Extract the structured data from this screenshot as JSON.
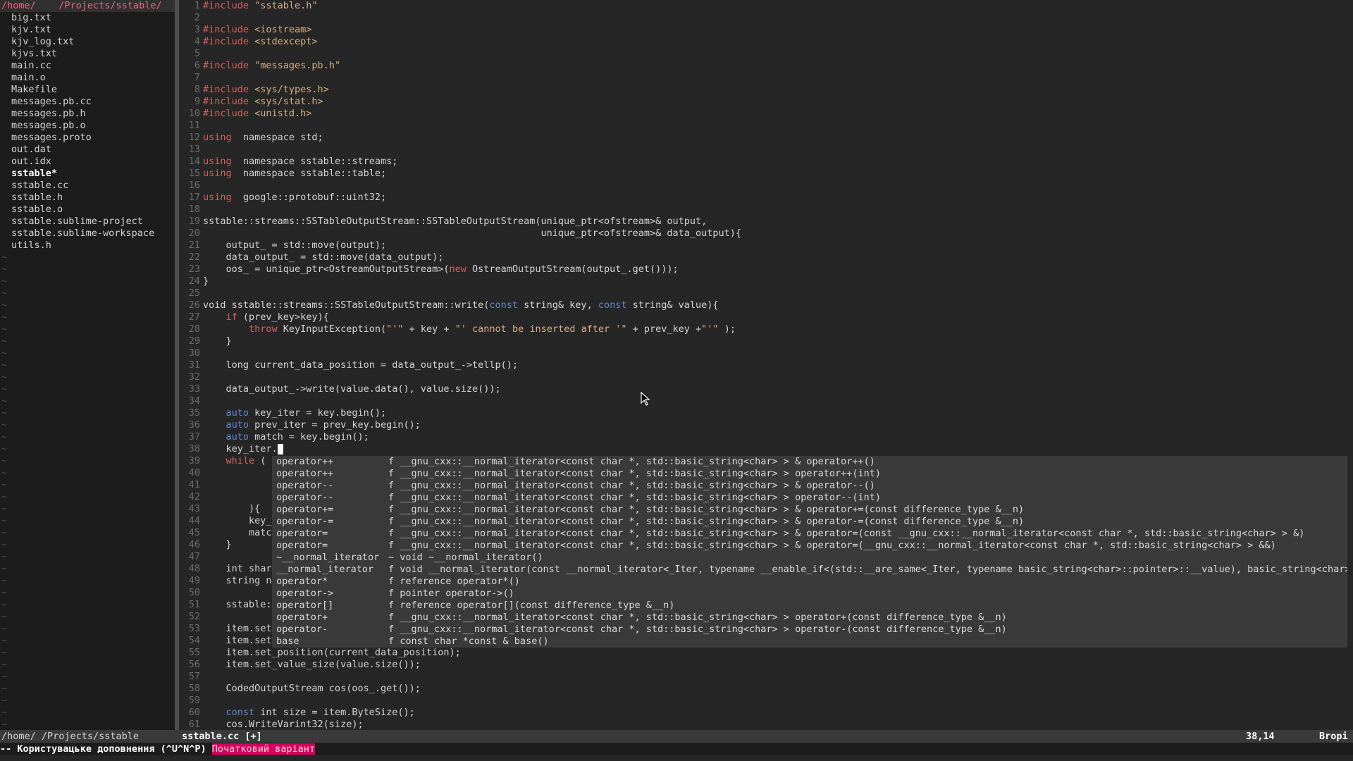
{
  "tree": {
    "root": "/home/    /Projects/sstable/",
    "files": [
      {
        "name": "big.txt"
      },
      {
        "name": "kjv.txt"
      },
      {
        "name": "kjv_log.txt"
      },
      {
        "name": "kjvs.txt"
      },
      {
        "name": "main.cc"
      },
      {
        "name": "main.o"
      },
      {
        "name": "Makefile"
      },
      {
        "name": "messages.pb.cc"
      },
      {
        "name": "messages.pb.h"
      },
      {
        "name": "messages.pb.o"
      },
      {
        "name": "messages.proto"
      },
      {
        "name": "out.dat"
      },
      {
        "name": "out.idx"
      },
      {
        "name": "sstable*",
        "bold": true
      },
      {
        "name": "sstable.cc"
      },
      {
        "name": "sstable.h"
      },
      {
        "name": "sstable.o"
      },
      {
        "name": "sstable.sublime-project"
      },
      {
        "name": "sstable.sublime-workspace"
      },
      {
        "name": "utils.h"
      }
    ],
    "tilde": "~"
  },
  "editor": {
    "lines": [
      {
        "n": "1",
        "segs": [
          [
            "pp",
            "#include "
          ],
          [
            "str",
            "\"sstable.h\""
          ]
        ]
      },
      {
        "n": "2",
        "segs": []
      },
      {
        "n": "3",
        "segs": [
          [
            "pp",
            "#include "
          ],
          [
            "str",
            "<iostream>"
          ]
        ]
      },
      {
        "n": "4",
        "segs": [
          [
            "pp",
            "#include "
          ],
          [
            "str",
            "<stdexcept>"
          ]
        ]
      },
      {
        "n": "5",
        "segs": []
      },
      {
        "n": "6",
        "segs": [
          [
            "pp",
            "#include "
          ],
          [
            "str",
            "\"messages.pb.h\""
          ]
        ]
      },
      {
        "n": "7",
        "segs": []
      },
      {
        "n": "8",
        "segs": [
          [
            "pp",
            "#include "
          ],
          [
            "str",
            "<sys/types.h>"
          ]
        ]
      },
      {
        "n": "9",
        "segs": [
          [
            "pp",
            "#include "
          ],
          [
            "str",
            "<sys/stat.h>"
          ]
        ]
      },
      {
        "n": "10",
        "segs": [
          [
            "pp",
            "#include "
          ],
          [
            "str",
            "<unistd.h>"
          ]
        ]
      },
      {
        "n": "11",
        "segs": []
      },
      {
        "n": "12",
        "segs": [
          [
            "kw2",
            "using"
          ],
          [
            "",
            "  namespace std;"
          ]
        ]
      },
      {
        "n": "13",
        "segs": []
      },
      {
        "n": "14",
        "segs": [
          [
            "kw2",
            "using"
          ],
          [
            "",
            "  namespace sstable::streams;"
          ]
        ]
      },
      {
        "n": "15",
        "segs": [
          [
            "kw2",
            "using"
          ],
          [
            "",
            "  namespace sstable::table;"
          ]
        ]
      },
      {
        "n": "16",
        "segs": []
      },
      {
        "n": "17",
        "segs": [
          [
            "kw2",
            "using"
          ],
          [
            "",
            "  google::protobuf::uint32;"
          ]
        ]
      },
      {
        "n": "18",
        "segs": []
      },
      {
        "n": "19",
        "segs": [
          [
            "",
            "sstable::streams::SSTableOutputStream::SSTableOutputStream(unique_ptr<ofstream>& output,"
          ]
        ]
      },
      {
        "n": "20",
        "segs": [
          [
            "",
            "                                                           unique_ptr<ofstream>& data_output){"
          ]
        ]
      },
      {
        "n": "21",
        "segs": [
          [
            "",
            "    output_ = std::move(output);"
          ]
        ]
      },
      {
        "n": "22",
        "segs": [
          [
            "",
            "    data_output_ = std::move(data_output);"
          ]
        ]
      },
      {
        "n": "23",
        "segs": [
          [
            "",
            "    oos_ = unique_ptr<OstreamOutputStream>("
          ],
          [
            "kw2",
            "new"
          ],
          [
            "",
            " OstreamOutputStream(output_.get()));"
          ]
        ]
      },
      {
        "n": "24",
        "segs": [
          [
            "",
            "}"
          ]
        ]
      },
      {
        "n": "25",
        "segs": []
      },
      {
        "n": "26",
        "segs": [
          [
            "",
            "void sstable::streams::SSTableOutputStream::write("
          ],
          [
            "kw",
            "const"
          ],
          [
            "",
            " string& key, "
          ],
          [
            "kw",
            "const"
          ],
          [
            "",
            " string& value){"
          ]
        ]
      },
      {
        "n": "27",
        "segs": [
          [
            "",
            "    "
          ],
          [
            "kw2",
            "if"
          ],
          [
            "",
            " (prev_key>key){"
          ]
        ]
      },
      {
        "n": "28",
        "segs": [
          [
            "",
            "        "
          ],
          [
            "kw2",
            "throw"
          ],
          [
            "",
            " KeyInputException("
          ],
          [
            "str",
            "\"'\""
          ],
          [
            "",
            " + key + "
          ],
          [
            "str",
            "\"' cannot be inserted after '\""
          ],
          [
            "",
            " + prev_key +"
          ],
          [
            "str",
            "\"'\""
          ],
          [
            "",
            " );"
          ]
        ]
      },
      {
        "n": "29",
        "segs": [
          [
            "",
            "    }"
          ]
        ]
      },
      {
        "n": "30",
        "segs": []
      },
      {
        "n": "31",
        "segs": [
          [
            "",
            "    long current_data_position = data_output_->tellp();"
          ]
        ]
      },
      {
        "n": "32",
        "segs": []
      },
      {
        "n": "33",
        "segs": [
          [
            "",
            "    data_output_->write(value.data(), value.size());"
          ]
        ]
      },
      {
        "n": "34",
        "segs": []
      },
      {
        "n": "35",
        "segs": [
          [
            "",
            "    "
          ],
          [
            "kw",
            "auto"
          ],
          [
            "",
            " key_iter = key.begin();"
          ]
        ]
      },
      {
        "n": "36",
        "segs": [
          [
            "",
            "    "
          ],
          [
            "kw",
            "auto"
          ],
          [
            "",
            " prev_iter = prev_key.begin();"
          ]
        ]
      },
      {
        "n": "37",
        "segs": [
          [
            "",
            "    "
          ],
          [
            "kw",
            "auto"
          ],
          [
            "",
            " match = key.begin();"
          ]
        ]
      },
      {
        "n": "38",
        "segs": [
          [
            "",
            "    key_iter."
          ]
        ],
        "cursor": true
      },
      {
        "n": "39",
        "segs": [
          [
            "",
            "    "
          ],
          [
            "kw2",
            "while"
          ],
          [
            "",
            " ("
          ]
        ]
      },
      {
        "n": "40",
        "segs": []
      },
      {
        "n": "41",
        "segs": []
      },
      {
        "n": "42",
        "segs": []
      },
      {
        "n": "43",
        "segs": [
          [
            "",
            "        ){"
          ]
        ]
      },
      {
        "n": "44",
        "segs": [
          [
            "",
            "        key_"
          ]
        ]
      },
      {
        "n": "45",
        "segs": [
          [
            "",
            "        matc"
          ]
        ]
      },
      {
        "n": "46",
        "segs": [
          [
            "",
            "    }"
          ]
        ]
      },
      {
        "n": "47",
        "segs": []
      },
      {
        "n": "48",
        "segs": [
          [
            "",
            "    int shar"
          ]
        ]
      },
      {
        "n": "49",
        "segs": [
          [
            "",
            "    string n"
          ]
        ]
      },
      {
        "n": "50",
        "segs": []
      },
      {
        "n": "51",
        "segs": [
          [
            "",
            "    sstable:"
          ]
        ]
      },
      {
        "n": "52",
        "segs": []
      },
      {
        "n": "53",
        "segs": [
          [
            "",
            "    item.set"
          ]
        ]
      },
      {
        "n": "54",
        "segs": [
          [
            "",
            "    item.set"
          ]
        ]
      },
      {
        "n": "55",
        "segs": [
          [
            "",
            "    item.set_position(current_data_position);"
          ]
        ]
      },
      {
        "n": "56",
        "segs": [
          [
            "",
            "    item.set_value_size(value.size());"
          ]
        ]
      },
      {
        "n": "57",
        "segs": []
      },
      {
        "n": "58",
        "segs": [
          [
            "",
            "    CodedOutputStream cos(oos_.get());"
          ]
        ]
      },
      {
        "n": "59",
        "segs": []
      },
      {
        "n": "60",
        "segs": [
          [
            "",
            "    "
          ],
          [
            "kw",
            "const"
          ],
          [
            "",
            " int size = item.ByteSize();"
          ]
        ]
      },
      {
        "n": "61",
        "segs": [
          [
            "",
            "    cos.WriteVarint32(size);"
          ]
        ]
      }
    ]
  },
  "popup": {
    "items": [
      {
        "name": "operator++",
        "sig": "f __gnu_cxx::__normal_iterator<const char *, std::basic_string<char> > & operator++()"
      },
      {
        "name": "operator++",
        "sig": "f __gnu_cxx::__normal_iterator<const char *, std::basic_string<char> > operator++(int)"
      },
      {
        "name": "operator--",
        "sig": "f __gnu_cxx::__normal_iterator<const char *, std::basic_string<char> > & operator--()"
      },
      {
        "name": "operator--",
        "sig": "f __gnu_cxx::__normal_iterator<const char *, std::basic_string<char> > operator--(int)"
      },
      {
        "name": "operator+=",
        "sig": "f __gnu_cxx::__normal_iterator<const char *, std::basic_string<char> > & operator+=(const difference_type &__n)"
      },
      {
        "name": "operator-=",
        "sig": "f __gnu_cxx::__normal_iterator<const char *, std::basic_string<char> > & operator-=(const difference_type &__n)"
      },
      {
        "name": "operator=",
        "sig": "f __gnu_cxx::__normal_iterator<const char *, std::basic_string<char> > & operator=(const __gnu_cxx::__normal_iterator<const char *, std::basic_string<char> > &)"
      },
      {
        "name": "operator=",
        "sig": "f __gnu_cxx::__normal_iterator<const char *, std::basic_string<char> > & operator=(__gnu_cxx::__normal_iterator<const char *, std::basic_string<char> > &&)"
      },
      {
        "name": "~__normal_iterator",
        "sig": "~ void ~__normal_iterator()"
      },
      {
        "name": "__normal_iterator",
        "sig": "f void __normal_iterator(const __normal_iterator<_Iter, typename __enable_if<(std::__are_same<_Iter, typename basic_string<char>::pointer>::__value), basic_string<char> >:"
      },
      {
        "name": "operator*",
        "sig": "f reference operator*()"
      },
      {
        "name": "operator->",
        "sig": "f pointer operator->()"
      },
      {
        "name": "operator[]",
        "sig": "f reference operator[](const difference_type &__n)"
      },
      {
        "name": "operator+",
        "sig": "f __gnu_cxx::__normal_iterator<const char *, std::basic_string<char> > operator+(const difference_type &__n)"
      },
      {
        "name": "operator-",
        "sig": "f __gnu_cxx::__normal_iterator<const char *, std::basic_string<char> > operator-(const difference_type &__n)"
      },
      {
        "name": "base",
        "sig": "f const char *const & base()"
      }
    ]
  },
  "statusbar": {
    "path": "/home/      /Projects/sstable",
    "file": "sstable.cc [+]",
    "position": "38,14",
    "mode": "Вropi"
  },
  "cmdline": {
    "message": "-- Користувацьке доповнення (^U^N^P)",
    "highlight": "Початковий варіант"
  },
  "colors": {
    "background": "#262626",
    "preprocessor": "#d75f5f",
    "string": "#d7af87",
    "keyword": "#5f87d7",
    "popup": "#3a3a3a",
    "mode_highlight": "#d7005f"
  }
}
